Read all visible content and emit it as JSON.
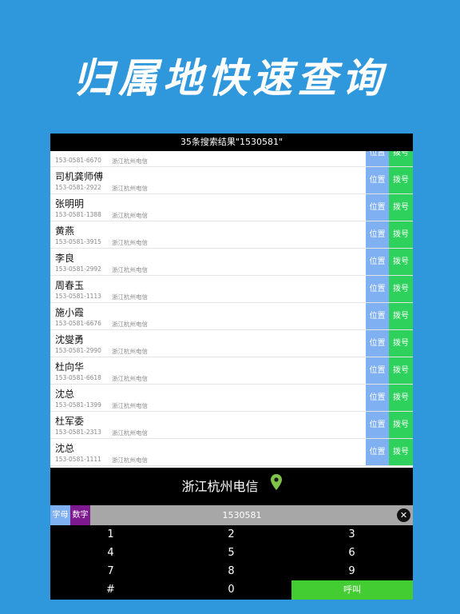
{
  "banner": {
    "title": "归属地快速查询"
  },
  "header": {
    "results_title": "35条搜索结果\"1530581\""
  },
  "row_buttons": {
    "location": "位置",
    "dial": "拨号"
  },
  "contacts": [
    {
      "name": "",
      "number": "153-0581-6670",
      "carrier": "浙江杭州电信"
    },
    {
      "name": "司机龚师傅",
      "number": "153-0581-2922",
      "carrier": "浙江杭州电信"
    },
    {
      "name": "张明明",
      "number": "153-0581-1388",
      "carrier": "浙江杭州电信"
    },
    {
      "name": "黄燕",
      "number": "153-0581-3915",
      "carrier": "浙江杭州电信"
    },
    {
      "name": "李良",
      "number": "153-0581-2992",
      "carrier": "浙江杭州电信"
    },
    {
      "name": "周春玉",
      "number": "153-0581-1113",
      "carrier": "浙江杭州电信"
    },
    {
      "name": "施小霞",
      "number": "153-0581-6676",
      "carrier": "浙江杭州电信"
    },
    {
      "name": "沈燮勇",
      "number": "153-0581-2990",
      "carrier": "浙江杭州电信"
    },
    {
      "name": "杜向华",
      "number": "153-0581-6618",
      "carrier": "浙江杭州电信"
    },
    {
      "name": "沈总",
      "number": "153-0581-1399",
      "carrier": "浙江杭州电信"
    },
    {
      "name": "杜军委",
      "number": "153-0581-2313",
      "carrier": "浙江杭州电信"
    },
    {
      "name": "沈总",
      "number": "153-0581-1111",
      "carrier": "浙江杭州电信"
    }
  ],
  "location_bar": {
    "text": "浙江杭州电信",
    "icon": "map-pin-icon",
    "icon_color": "#7fc34a"
  },
  "input": {
    "mode_letter": "字母",
    "mode_digit": "数字",
    "query": "1530581",
    "clear_icon": "clear-icon"
  },
  "keypad": {
    "keys": [
      "1",
      "2",
      "3",
      "4",
      "5",
      "6",
      "7",
      "8",
      "9",
      "#",
      "0"
    ],
    "call_label": "呼叫"
  },
  "colors": {
    "background": "#2f97dc",
    "location_button": "#7fb0f2",
    "dial_button": "#2ed15c",
    "call_button": "#44cc33",
    "digit_mode": "#7d1a8f"
  }
}
